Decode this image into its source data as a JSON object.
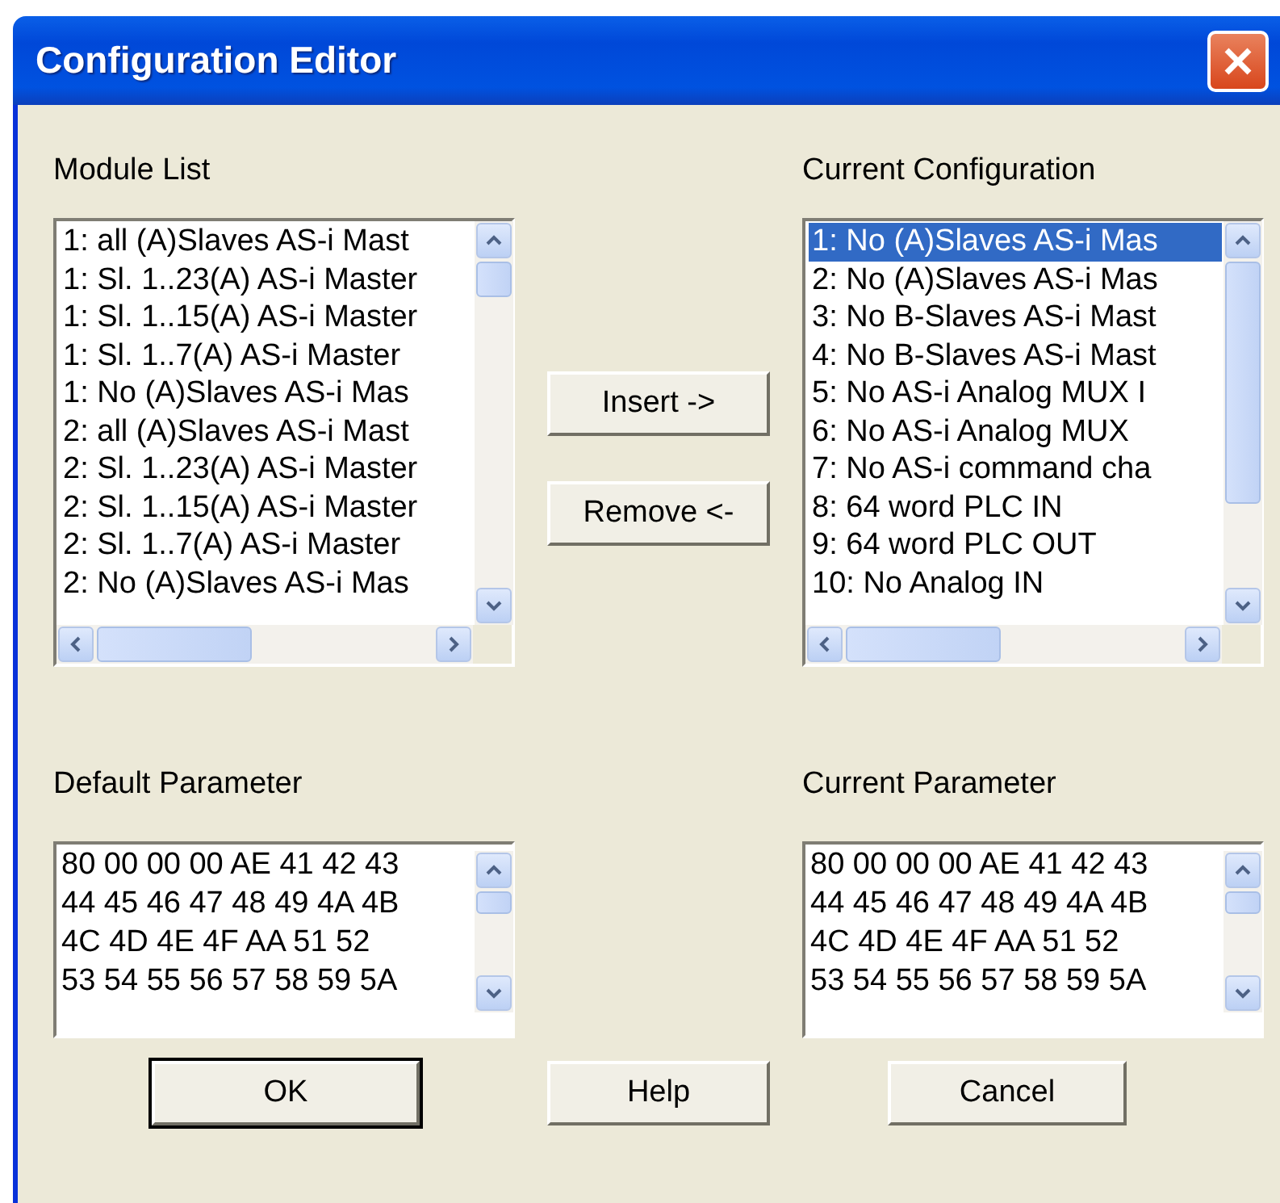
{
  "window": {
    "title": "Configuration Editor"
  },
  "module_list": {
    "label": "Module List",
    "items": [
      {
        "text": "1: all (A)Slaves AS-i Mast",
        "selected": false
      },
      {
        "text": "1: Sl. 1..23(A) AS-i Master",
        "selected": false
      },
      {
        "text": "1: Sl. 1..15(A) AS-i Master",
        "selected": false
      },
      {
        "text": "1: Sl. 1..7(A) AS-i Master",
        "selected": false
      },
      {
        "text": "1: No (A)Slaves AS-i Mas",
        "selected": false
      },
      {
        "text": "2: all (A)Slaves AS-i Mast",
        "selected": false
      },
      {
        "text": "2: Sl. 1..23(A) AS-i Master",
        "selected": false
      },
      {
        "text": "2: Sl. 1..15(A) AS-i Master",
        "selected": false
      },
      {
        "text": "2: Sl. 1..7(A) AS-i Master",
        "selected": false
      },
      {
        "text": "2: No (A)Slaves AS-i Mas",
        "selected": false
      }
    ]
  },
  "current_configuration": {
    "label": "Current Configuration",
    "items": [
      {
        "text": "1: No (A)Slaves AS-i Mas",
        "selected": true
      },
      {
        "text": "2: No (A)Slaves AS-i Mas",
        "selected": false
      },
      {
        "text": "3: No B-Slaves AS-i Mast",
        "selected": false
      },
      {
        "text": "4: No B-Slaves AS-i Mast",
        "selected": false
      },
      {
        "text": "5: No AS-i Analog MUX I",
        "selected": false
      },
      {
        "text": "6: No AS-i Analog MUX",
        "selected": false
      },
      {
        "text": "7: No AS-i command cha",
        "selected": false
      },
      {
        "text": "8: 64 word PLC IN",
        "selected": false
      },
      {
        "text": "9: 64 word PLC OUT",
        "selected": false
      },
      {
        "text": "10: No Analog IN",
        "selected": false
      }
    ]
  },
  "middle_buttons": [
    "Insert ->",
    "Remove <-"
  ],
  "default_parameter": {
    "label": "Default Parameter",
    "lines": [
      "80 00 00 00 AE 41 42 43",
      "44 45 46 47 48 49 4A 4B",
      "4C 4D 4E 4F AA 51 52",
      "53 54 55 56 57 58 59 5A"
    ]
  },
  "current_parameter": {
    "label": "Current Parameter",
    "lines": [
      "80 00 00 00 AE 41 42 43",
      "44 45 46 47 48 49 4A 4B",
      "4C 4D 4E 4F AA 51 52",
      "53 54 55 56 57 58 59 5A"
    ]
  },
  "buttons": [
    {
      "label": "OK",
      "default": true
    },
    {
      "label": "Help",
      "default": false
    },
    {
      "label": "Cancel",
      "default": false
    }
  ]
}
